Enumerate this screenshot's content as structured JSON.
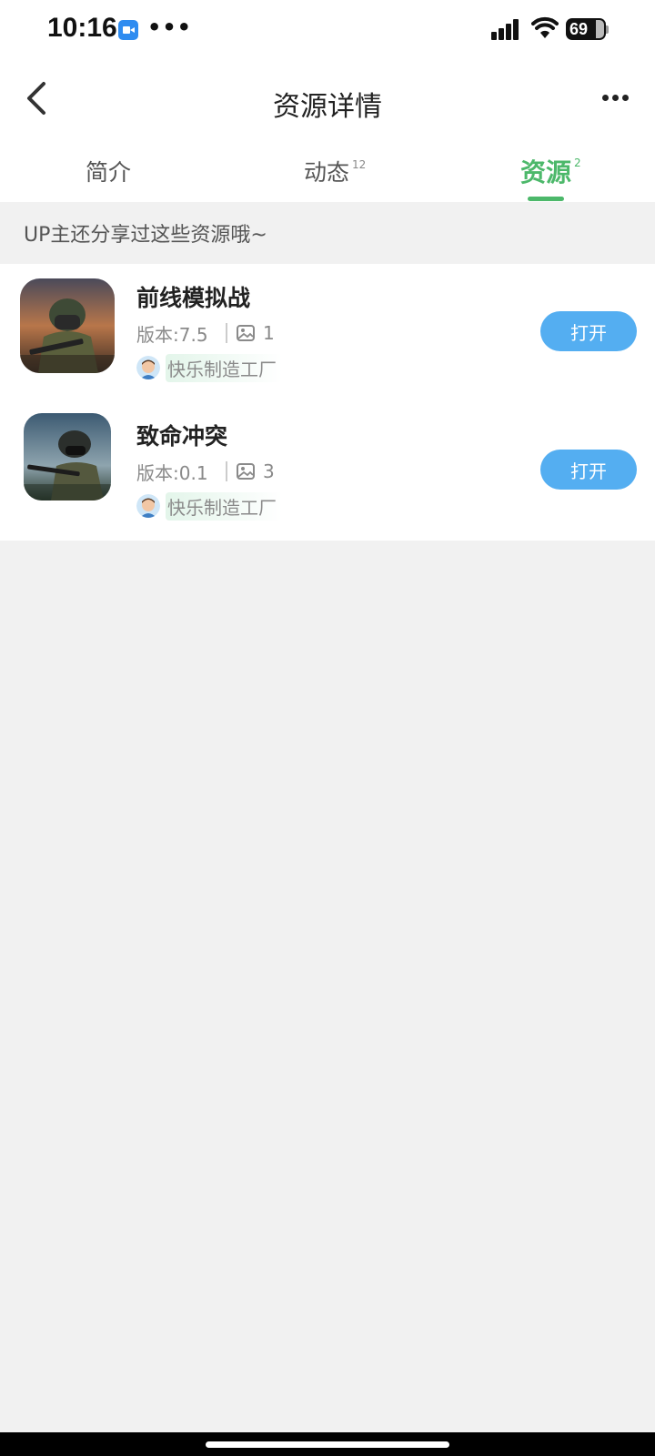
{
  "status_bar": {
    "time": "10:16",
    "more": "•••",
    "battery": "69",
    "icons": [
      "video-call-icon",
      "signal-icon",
      "wifi-icon",
      "battery-icon"
    ]
  },
  "header": {
    "title": "资源详情",
    "back_icon": "chevron-left-icon",
    "more_icon": "more-horizontal-icon"
  },
  "tabs": [
    {
      "label": "简介",
      "count": ""
    },
    {
      "label": "动态",
      "count": "12"
    },
    {
      "label": "资源",
      "count": "2",
      "active": true
    }
  ],
  "section": {
    "title": "UP主还分享过这些资源哦~"
  },
  "resources": [
    {
      "name": "前线模拟战",
      "version": "版本:7.5",
      "image_count": "1",
      "author": "快乐制造工厂",
      "button": "打开"
    },
    {
      "name": "致命冲突",
      "version": "版本:0.1",
      "image_count": "3",
      "author": "快乐制造工厂",
      "button": "打开"
    }
  ],
  "colors": {
    "accent_green": "#4cb86a",
    "button_blue": "#54aef1",
    "background": "#f1f1f1"
  }
}
